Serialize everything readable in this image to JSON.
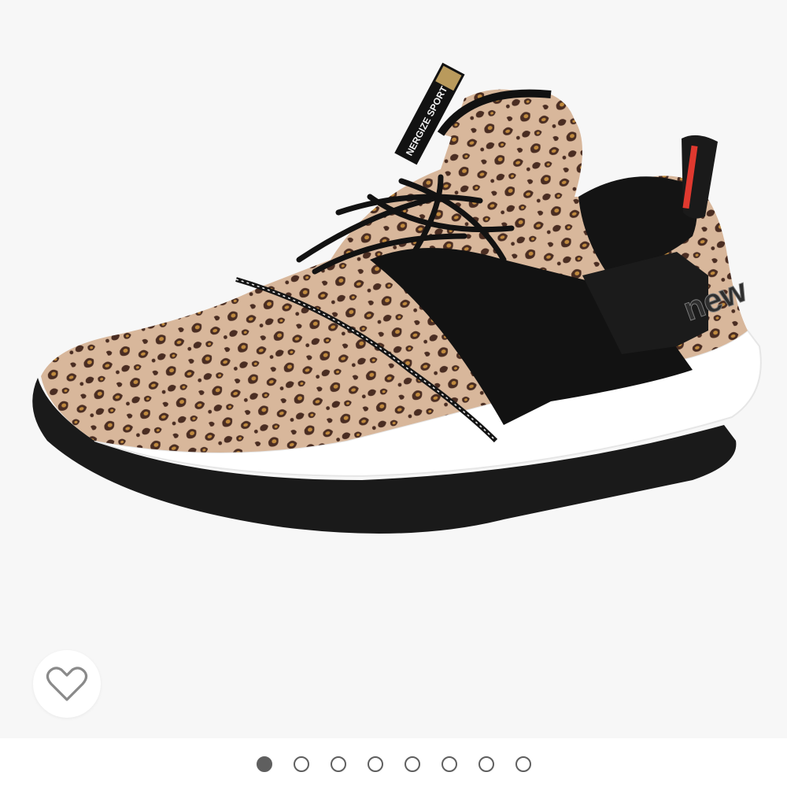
{
  "product": {
    "image_alt": "Leopard print slip-on sneaker",
    "brand_mark": "new",
    "tongue_label": "NERGIZE SPORT"
  },
  "wishlist": {
    "icon": "heart-outline-icon",
    "favorited": false
  },
  "carousel": {
    "total": 8,
    "active": 1
  },
  "colors": {
    "dot": "#5f5f5f",
    "background": "#f7f7f7",
    "print_base": "#d8b79b",
    "pull_tab": "#e0392f"
  }
}
